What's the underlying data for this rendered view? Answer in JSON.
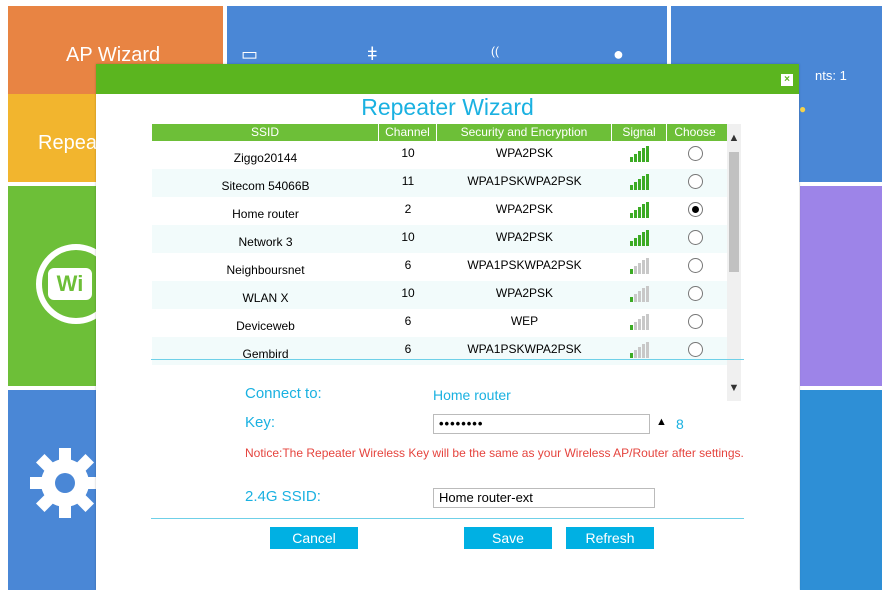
{
  "background": {
    "ap_wizard_label": "AP Wizard",
    "repeater_label": "Repea",
    "clients_text": "nts: 1",
    "wifi_logo_text": "Wi"
  },
  "dialog": {
    "title": "Repeater Wizard",
    "close_label": "×",
    "columns": [
      "SSID",
      "Channel",
      "Security and Encryption",
      "Signal",
      "Choose"
    ],
    "networks": [
      {
        "ssid": "Ziggo20144",
        "channel": "10",
        "security": "WPA2PSK",
        "signal": 5,
        "selected": false
      },
      {
        "ssid": "Sitecom 54066B",
        "channel": "11",
        "security": "WPA1PSKWPA2PSK",
        "signal": 5,
        "selected": false
      },
      {
        "ssid": "Home router",
        "channel": "2",
        "security": "WPA2PSK",
        "signal": 5,
        "selected": true
      },
      {
        "ssid": "Network 3",
        "channel": "10",
        "security": "WPA2PSK",
        "signal": 5,
        "selected": false
      },
      {
        "ssid": "Neighboursnet",
        "channel": "6",
        "security": "WPA1PSKWPA2PSK",
        "signal": 1,
        "selected": false
      },
      {
        "ssid": "WLAN X",
        "channel": "10",
        "security": "WPA2PSK",
        "signal": 1,
        "selected": false
      },
      {
        "ssid": "Deviceweb",
        "channel": "6",
        "security": "WEP",
        "signal": 1,
        "selected": false
      },
      {
        "ssid": "Gembird",
        "channel": "6",
        "security": "WPA1PSKWPA2PSK",
        "signal": 1,
        "selected": false
      }
    ],
    "connect_to_label": "Connect to:",
    "connect_to_value": "Home router",
    "key_label": "Key:",
    "key_value": "••••••••",
    "key_length": "8",
    "notice": "Notice:The Repeater Wireless Key will be the same as your Wireless AP/Router after settings.",
    "ssid_label": "2.4G SSID:",
    "ssid_value": "Home router-ext",
    "cancel_label": "Cancel",
    "save_label": "Save",
    "refresh_label": "Refresh"
  },
  "colors": {
    "header_green": "#5bb51f",
    "accent_blue": "#1ab1e1",
    "button_blue": "#00b0e3",
    "notice_red": "#e5443e"
  }
}
